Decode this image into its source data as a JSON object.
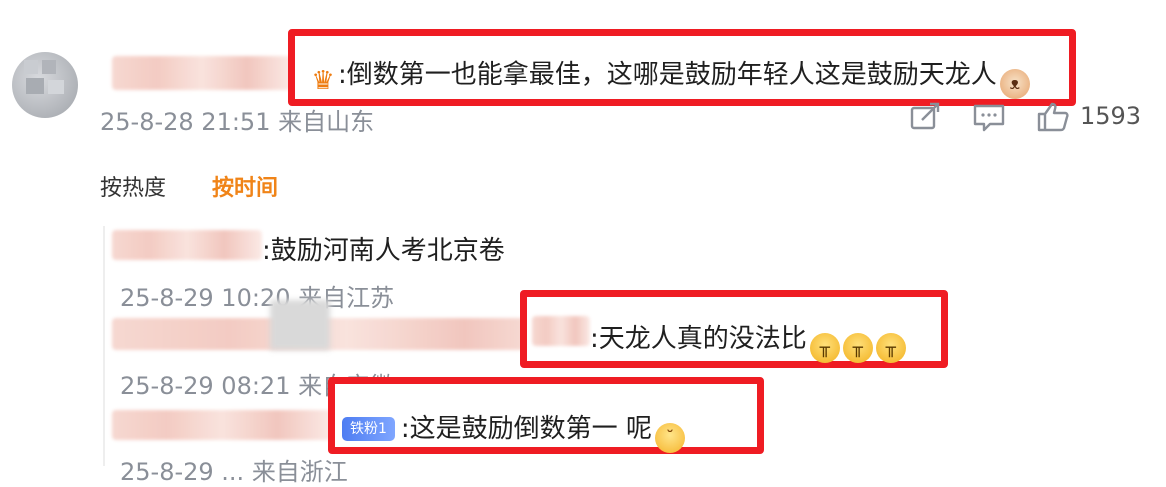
{
  "main_comment": {
    "text": ":倒数第一也能拿最佳，这哪是鼓励年轻人这是鼓励天龙人",
    "meta": "25-8-28 21:51 来自山东",
    "like_count": "1593",
    "icons": [
      "crown-icon",
      "cat-emoji-icon"
    ]
  },
  "sort_tabs": [
    {
      "label": "按热度",
      "active": false
    },
    {
      "label": "按时间",
      "active": true
    }
  ],
  "replies": [
    {
      "text": ":鼓励河南人考北京卷",
      "meta": "25-8-29 10:20 来自江苏"
    },
    {
      "text": ":天龙人真的没法比",
      "meta": "25-8-29 08:21 来自安徽",
      "emojis": [
        "cry-emoji-icon",
        "cry-emoji-icon",
        "cry-emoji-icon"
      ]
    },
    {
      "badge": "铁粉1",
      "text": ":这是鼓励倒数第一 呢",
      "meta": "25-8-29 ... 来自浙江",
      "emojis": [
        "shy-emoji-icon"
      ]
    }
  ],
  "colors": {
    "highlight_border": "#ef1c23",
    "active_tab": "#f08418",
    "meta_text": "#8a8f98"
  }
}
